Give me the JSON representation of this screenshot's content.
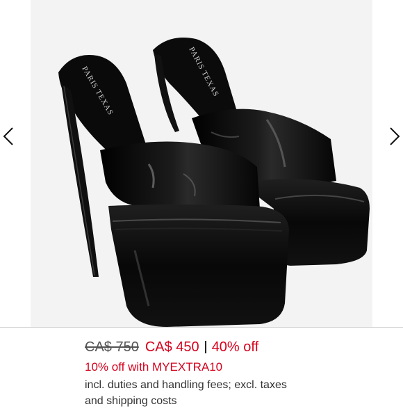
{
  "gallery": {
    "brand_imprint": "PARIS TEXAS",
    "product_image": "black-patent-platform-mule-pair"
  },
  "navigation": {
    "prev_icon": "chevron-left-icon",
    "next_icon": "chevron-right-icon"
  },
  "pricing": {
    "original_price": "CA$ 750",
    "sale_price": "CA$ 450",
    "discount": "40% off",
    "promo_text": "10% off with MYEXTRA10",
    "duties_text": "incl. duties and handling fees; excl. taxes and shipping costs"
  },
  "colors": {
    "sale_red": "#d6001c",
    "photo_background": "#f3f3f3",
    "shoe_black": "#0a0a0a"
  }
}
